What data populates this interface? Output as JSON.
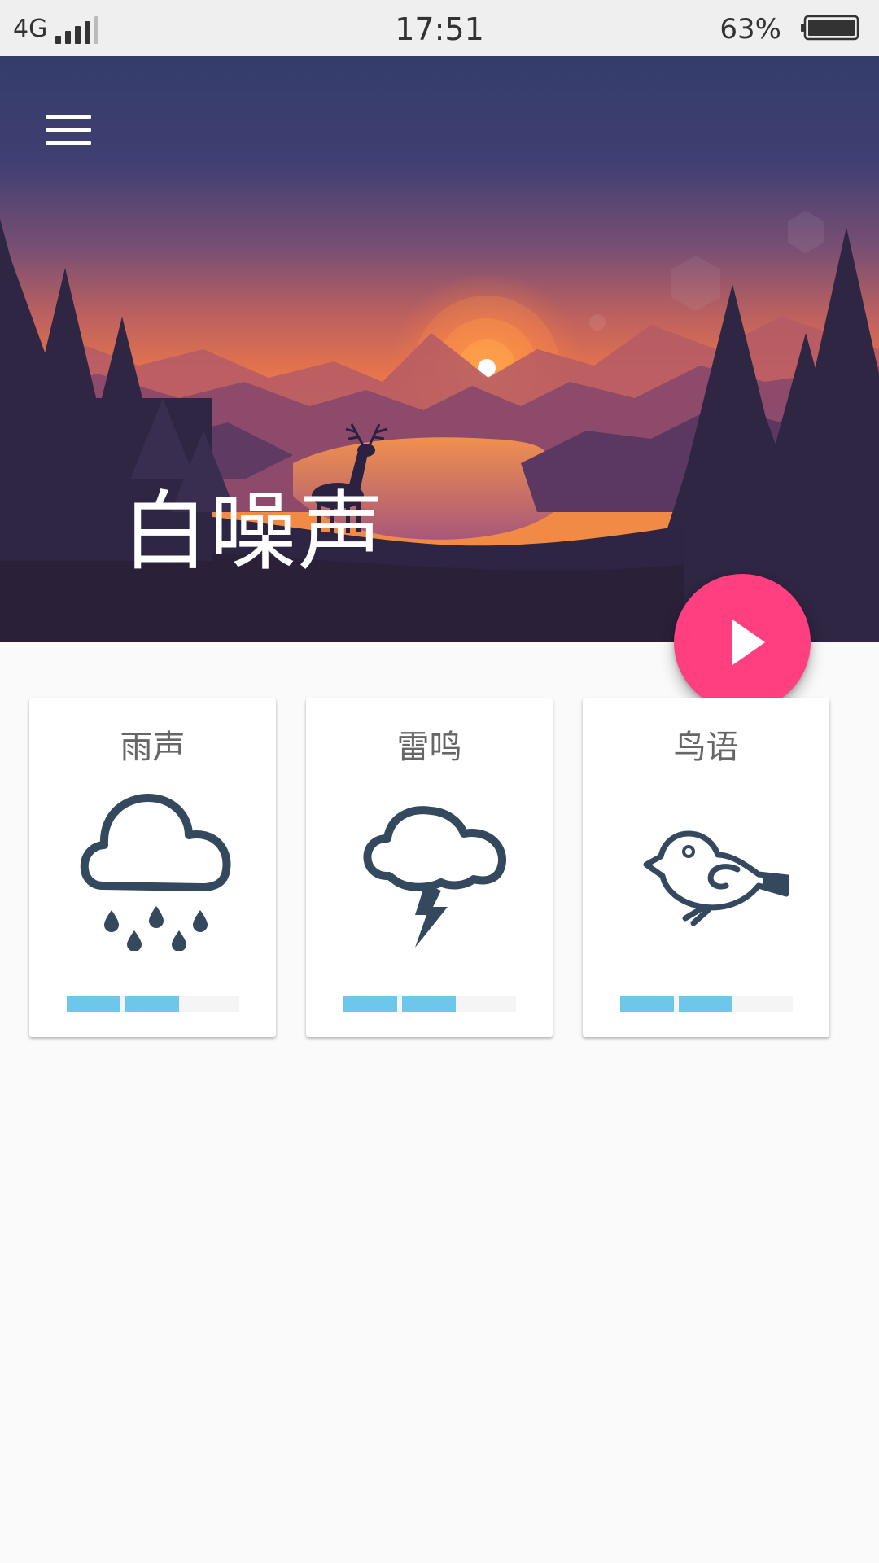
{
  "status_bar": {
    "network": "4G",
    "time": "17:51",
    "battery_percent": "63%",
    "battery_level": 0.63
  },
  "hero": {
    "title": "白噪声",
    "menu_icon": "hamburger-menu-icon",
    "play_icon": "play-icon"
  },
  "colors": {
    "accent": "#ff3f7f",
    "volume_fill": "#6cc7ea",
    "icon": "#34495e",
    "card_title": "#666666"
  },
  "sounds": [
    {
      "label": "雨声",
      "icon": "rain-cloud-icon",
      "volume_segments_filled": 2,
      "volume_segments_total": 3
    },
    {
      "label": "雷鸣",
      "icon": "thunder-cloud-icon",
      "volume_segments_filled": 2,
      "volume_segments_total": 3
    },
    {
      "label": "鸟语",
      "icon": "bird-icon",
      "volume_segments_filled": 2,
      "volume_segments_total": 3
    }
  ]
}
